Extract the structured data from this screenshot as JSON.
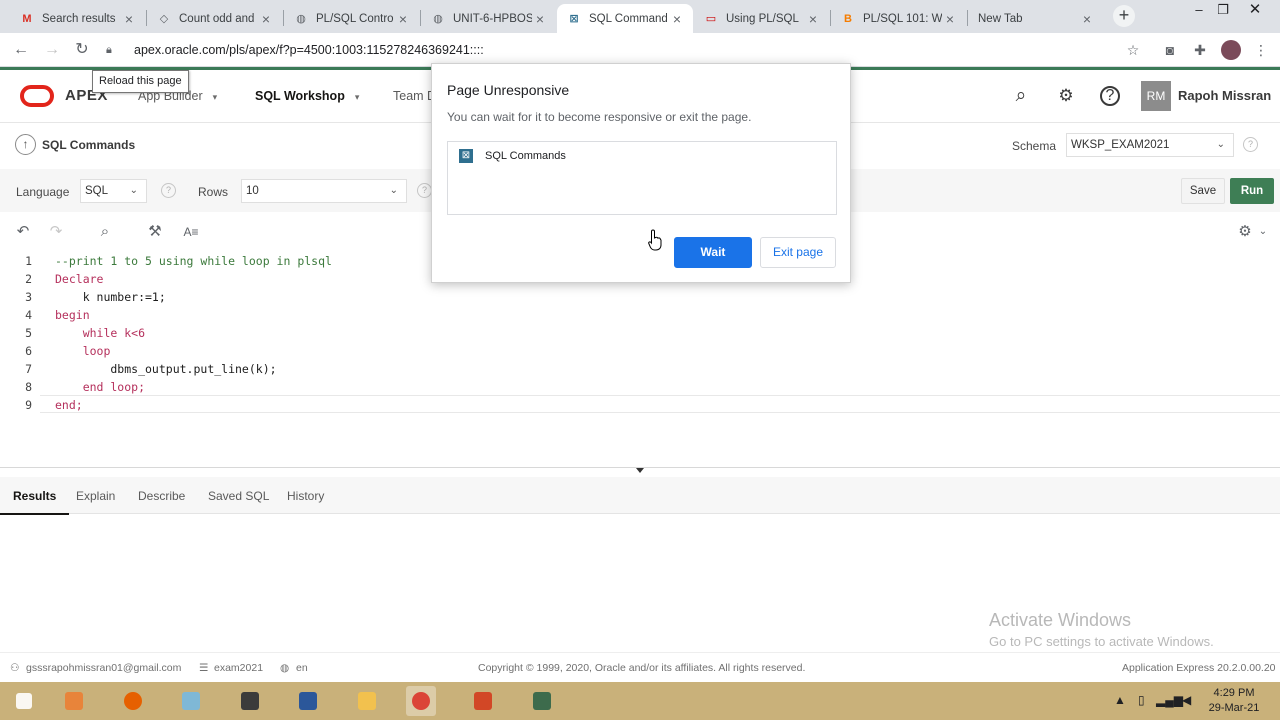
{
  "browser": {
    "tabs": [
      {
        "title": "Search results",
        "fav": "M"
      },
      {
        "title": "Count odd and",
        "fav": "◇"
      },
      {
        "title": "PL/SQL Contro",
        "fav": "◍"
      },
      {
        "title": "UNIT-6-HPBOS",
        "fav": "◍"
      },
      {
        "title": "SQL Command",
        "fav": "⊠"
      },
      {
        "title": "Using PL/SQL",
        "fav": "▭"
      },
      {
        "title": "PL/SQL 101: W",
        "fav": "B"
      },
      {
        "title": "New Tab",
        "fav": ""
      }
    ],
    "new_tab": "+",
    "url": "apex.oracle.com/pls/apex/f?p=4500:1003:115278246369241::::",
    "tooltip": "Reload this page"
  },
  "apex": {
    "product": "APEX",
    "nav": [
      "App Builder",
      "SQL Workshop",
      "Team D"
    ],
    "user_initials": "RM",
    "user_name": "Rapoh Missran",
    "page_title": "SQL Commands",
    "schema_label": "Schema",
    "schema_value": "WKSP_EXAM2021",
    "language_label": "Language",
    "language_value": "SQL",
    "rows_label": "Rows",
    "rows_value": "10",
    "save_label": "Save",
    "run_label": "Run",
    "code_lines": [
      "--print 1 to 5 using while loop in plsql",
      "Declare",
      "    k number:=1;",
      "begin",
      "    while k<6",
      "    loop",
      "        dbms_output.put_line(k);",
      "    end loop;",
      "end;"
    ],
    "result_tabs": [
      "Results",
      "Explain",
      "Describe",
      "Saved SQL",
      "History"
    ],
    "footer": {
      "email": "gsssrapohmissran01@gmail.com",
      "workspace": "exam2021",
      "lang": "en",
      "copyright": "Copyright © 1999, 2020, Oracle and/or its affiliates. All rights reserved.",
      "version": "Application Express 20.2.0.00.20"
    }
  },
  "modal": {
    "title": "Page Unresponsive",
    "message": "You can wait for it to become responsive or exit the page.",
    "page_name": "SQL Commands",
    "wait_label": "Wait",
    "exit_label": "Exit page"
  },
  "watermark": {
    "line1": "Activate Windows",
    "line2": "Go to PC settings to activate Windows."
  },
  "taskbar": {
    "time": "4:29 PM",
    "date": "29-Mar-21"
  },
  "colors": {
    "apex_green": "#3e7e55",
    "oracle_red": "#e2251b",
    "chrome_blue": "#1a73e8",
    "taskbar": "#c9b17a"
  }
}
